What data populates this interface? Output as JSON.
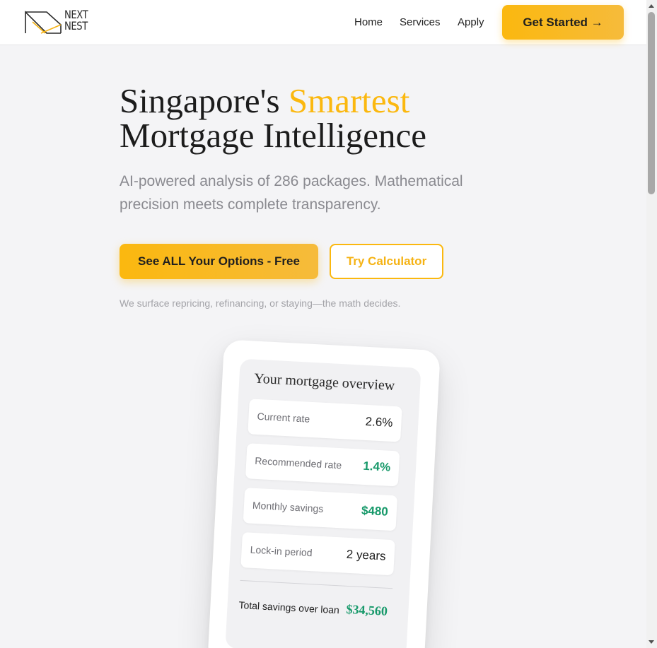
{
  "header": {
    "logo_text": "NEXT NEST",
    "nav": {
      "home": "Home",
      "services": "Services",
      "apply": "Apply"
    },
    "cta_label": "Get Started →"
  },
  "hero": {
    "title_prefix": "Singapore's ",
    "title_accent": "Smartest",
    "title_line2": "Mortgage Intelligence",
    "subtitle": "AI-powered analysis of 286 packages. Mathematical precision meets complete transparency.",
    "primary_button": "See ALL Your Options - Free",
    "secondary_button": "Try Calculator",
    "note": "We surface repricing, refinancing, or staying—the math decides."
  },
  "overview": {
    "title": "Your mortgage overview",
    "stats": [
      {
        "label": "Current rate",
        "value": "2.6%"
      },
      {
        "label": "Recommended rate",
        "value": "1.4%"
      },
      {
        "label": "Monthly savings",
        "value": "$480"
      },
      {
        "label": "Lock-in period",
        "value": "2 years"
      }
    ],
    "total_label": "Total savings over loan",
    "total_value": "$34,560"
  },
  "colors": {
    "accent": "#fbb80f",
    "green": "#17996a",
    "background": "#f4f4f6"
  }
}
